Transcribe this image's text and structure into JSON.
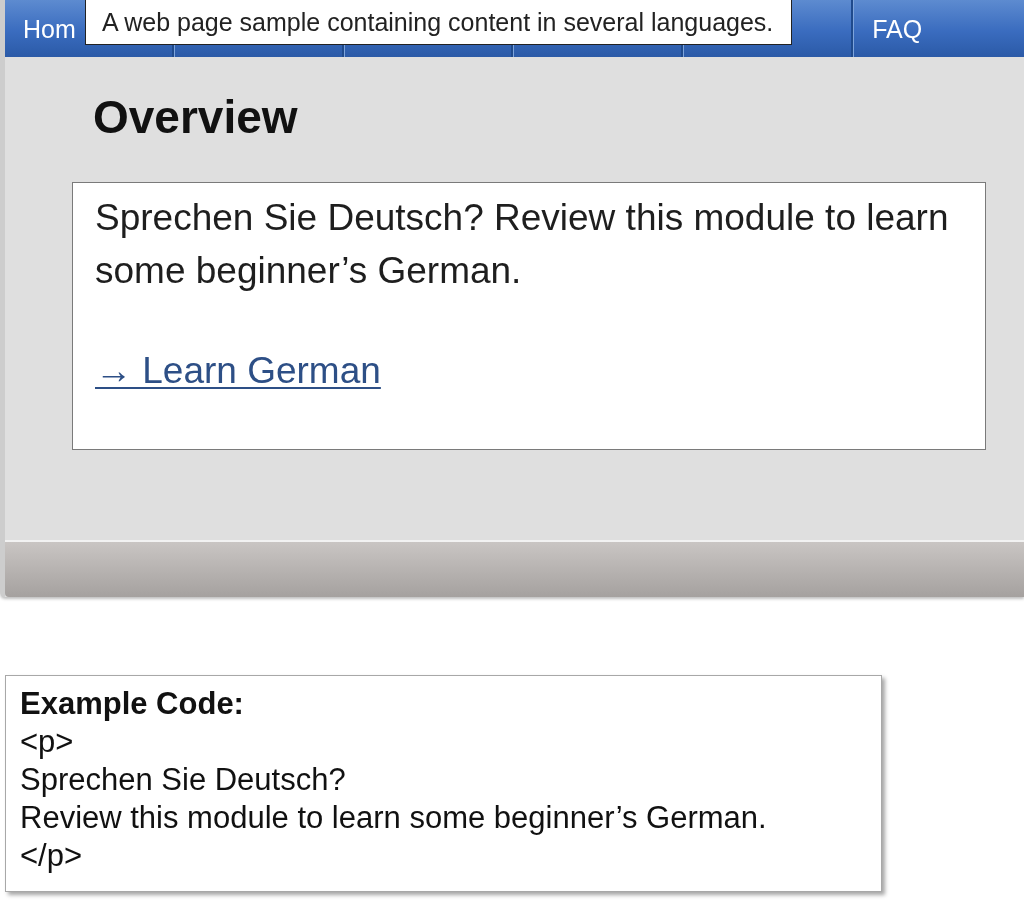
{
  "nav": {
    "tabs": [
      {
        "label": "Hom"
      },
      {
        "label": "FAQ"
      }
    ]
  },
  "tooltip": {
    "text": "A web page sample containing content in several languages."
  },
  "page": {
    "heading": "Overview",
    "card": {
      "text": "Sprechen Sie Deutsch? Review this module to learn some beginner’s German.",
      "link": "→ Learn German"
    }
  },
  "code_example": {
    "title": "Example Code:",
    "lines": [
      "<p>",
      "Sprechen Sie Deutsch?",
      "Review this module to learn some beginner’s German.",
      "</p>"
    ]
  }
}
